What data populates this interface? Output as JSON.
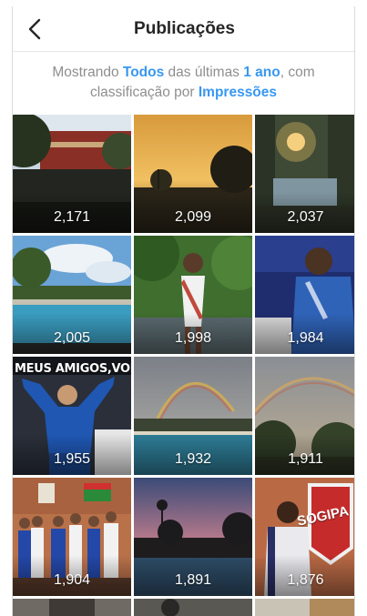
{
  "header": {
    "title": "Publicações",
    "back_icon": "chevron-left-icon"
  },
  "filter": {
    "prefix": "Mostrando ",
    "scope": "Todos",
    "middle": " das últimas ",
    "period": "1 ano",
    "suffix": ", com classificação por ",
    "metric": "Impressões"
  },
  "colors": {
    "link": "#3897f0",
    "muted": "#8e8e8e",
    "text": "#262626"
  },
  "posts": [
    {
      "impressions": "2,171",
      "scene": "building-trees"
    },
    {
      "impressions": "2,099",
      "scene": "sunset-trees"
    },
    {
      "impressions": "2,037",
      "scene": "sun-through-trees"
    },
    {
      "impressions": "2,005",
      "scene": "pool-sky"
    },
    {
      "impressions": "1,998",
      "scene": "woman-sash"
    },
    {
      "impressions": "1,984",
      "scene": "judoka-blue"
    },
    {
      "impressions": "1,955",
      "scene": "judoka-celebrating",
      "overlay_text": "MEUS AMIGOS,VOLTE"
    },
    {
      "impressions": "1,932",
      "scene": "rainbow-pool"
    },
    {
      "impressions": "1,911",
      "scene": "rainbow-trees"
    },
    {
      "impressions": "1,904",
      "scene": "judo-team"
    },
    {
      "impressions": "1,891",
      "scene": "dusk-pool"
    },
    {
      "impressions": "1,876",
      "scene": "woman-sogipa",
      "overlay_text": "SOGIPA"
    },
    {
      "impressions": "",
      "scene": "partial"
    },
    {
      "impressions": "",
      "scene": "partial"
    },
    {
      "impressions": "",
      "scene": "partial"
    }
  ]
}
